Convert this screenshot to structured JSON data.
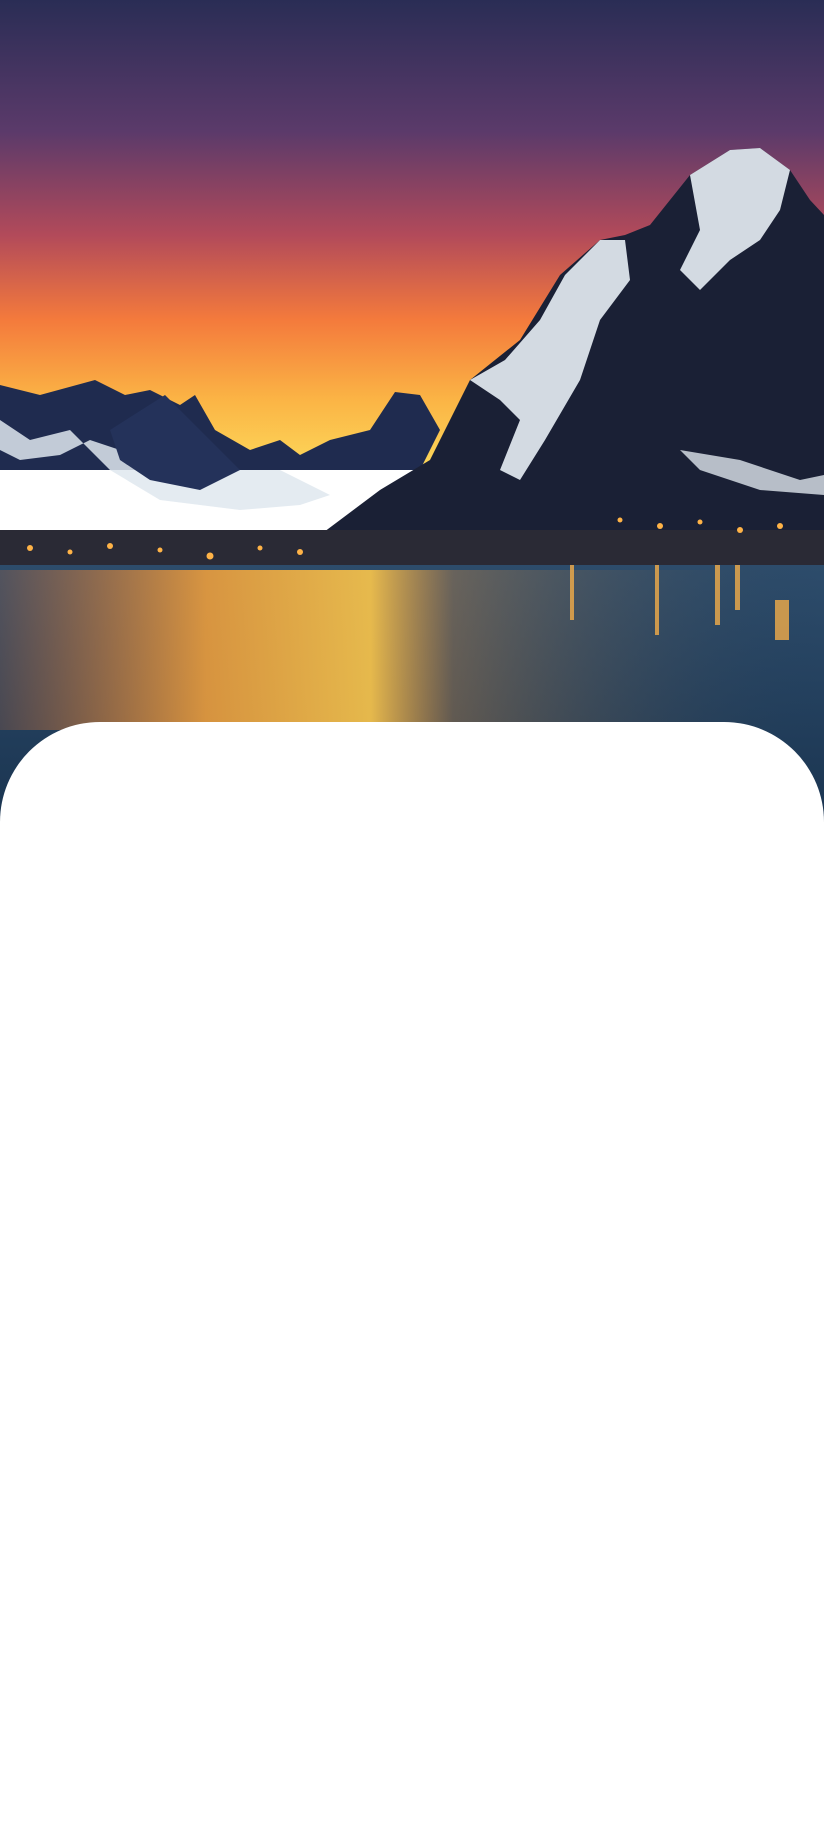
{
  "hero_image": {
    "description_icon": "landscape-photo",
    "colors": {
      "sky_top": "#2a2d55",
      "sky_mid": "#8a3d6a",
      "sky_glow": "#f47a3c",
      "horizon": "#fcd85a",
      "water_dark": "#1f3a55",
      "mountain_dark": "#1a2035",
      "snow": "#e8eef5"
    }
  },
  "sheet": {
    "background": "#ffffff"
  }
}
